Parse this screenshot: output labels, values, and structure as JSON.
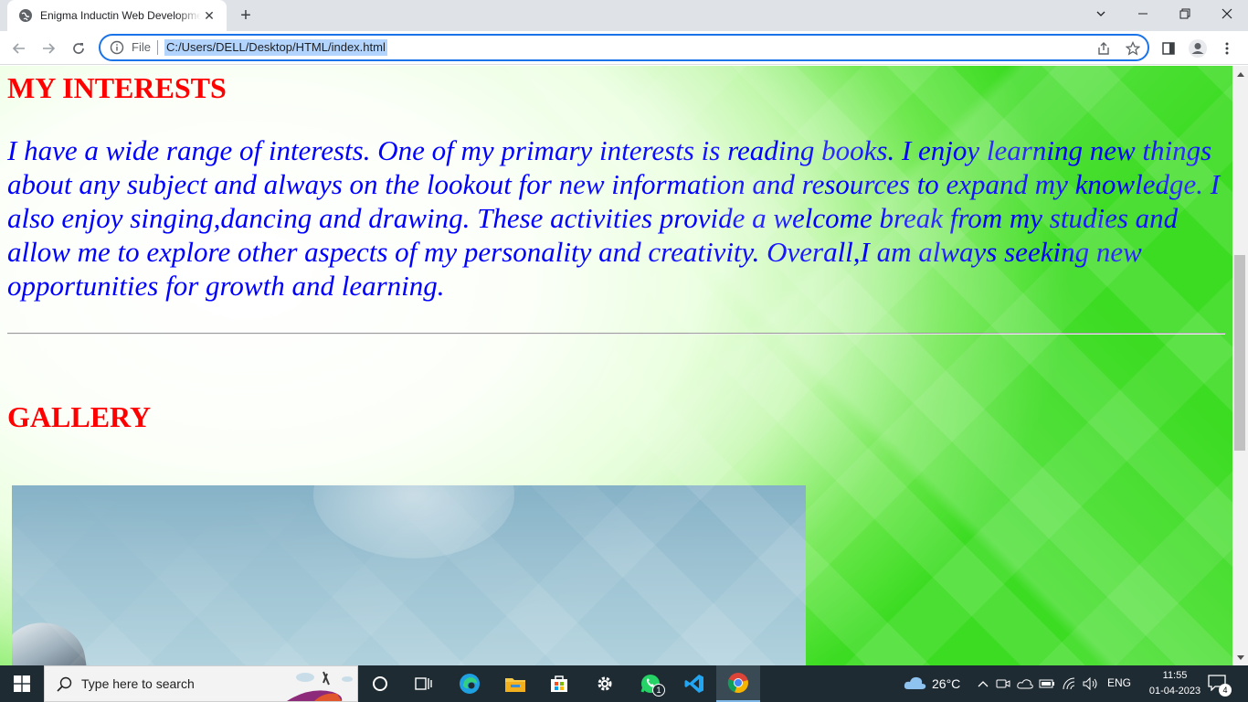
{
  "browser": {
    "tab": {
      "title": "Enigma Inductin Web Development",
      "close": "✕"
    },
    "new_tab": "+",
    "omnibox": {
      "scheme_label": "File",
      "url": "C:/Users/DELL/Desktop/HTML/index.html"
    }
  },
  "page": {
    "interests_heading": "MY INTERESTS",
    "interests_text": "I have a wide range of interests. One of my primary interests is reading books. I enjoy learning new things about any subject and always on the lookout for new information and resources to expand my knowledge. I also enjoy singing,dancing and drawing. These activities provide a welcome break from my studies and allow me to explore other aspects of my personality and creativity. Overall,I am always seeking new opportunities for growth and learning.",
    "gallery_heading": "GALLERY"
  },
  "taskbar": {
    "search_placeholder": "Type here to search",
    "whatsapp_badge": "1",
    "weather": "26°C",
    "language": "ENG",
    "time": "11:55",
    "date": "01-04-2023",
    "notifications_count": "4"
  },
  "colors": {
    "heading": "#ff0000",
    "body_text": "#0000ff",
    "omnibox_focus": "#1a73e8",
    "background_green": "#3cdc22"
  }
}
